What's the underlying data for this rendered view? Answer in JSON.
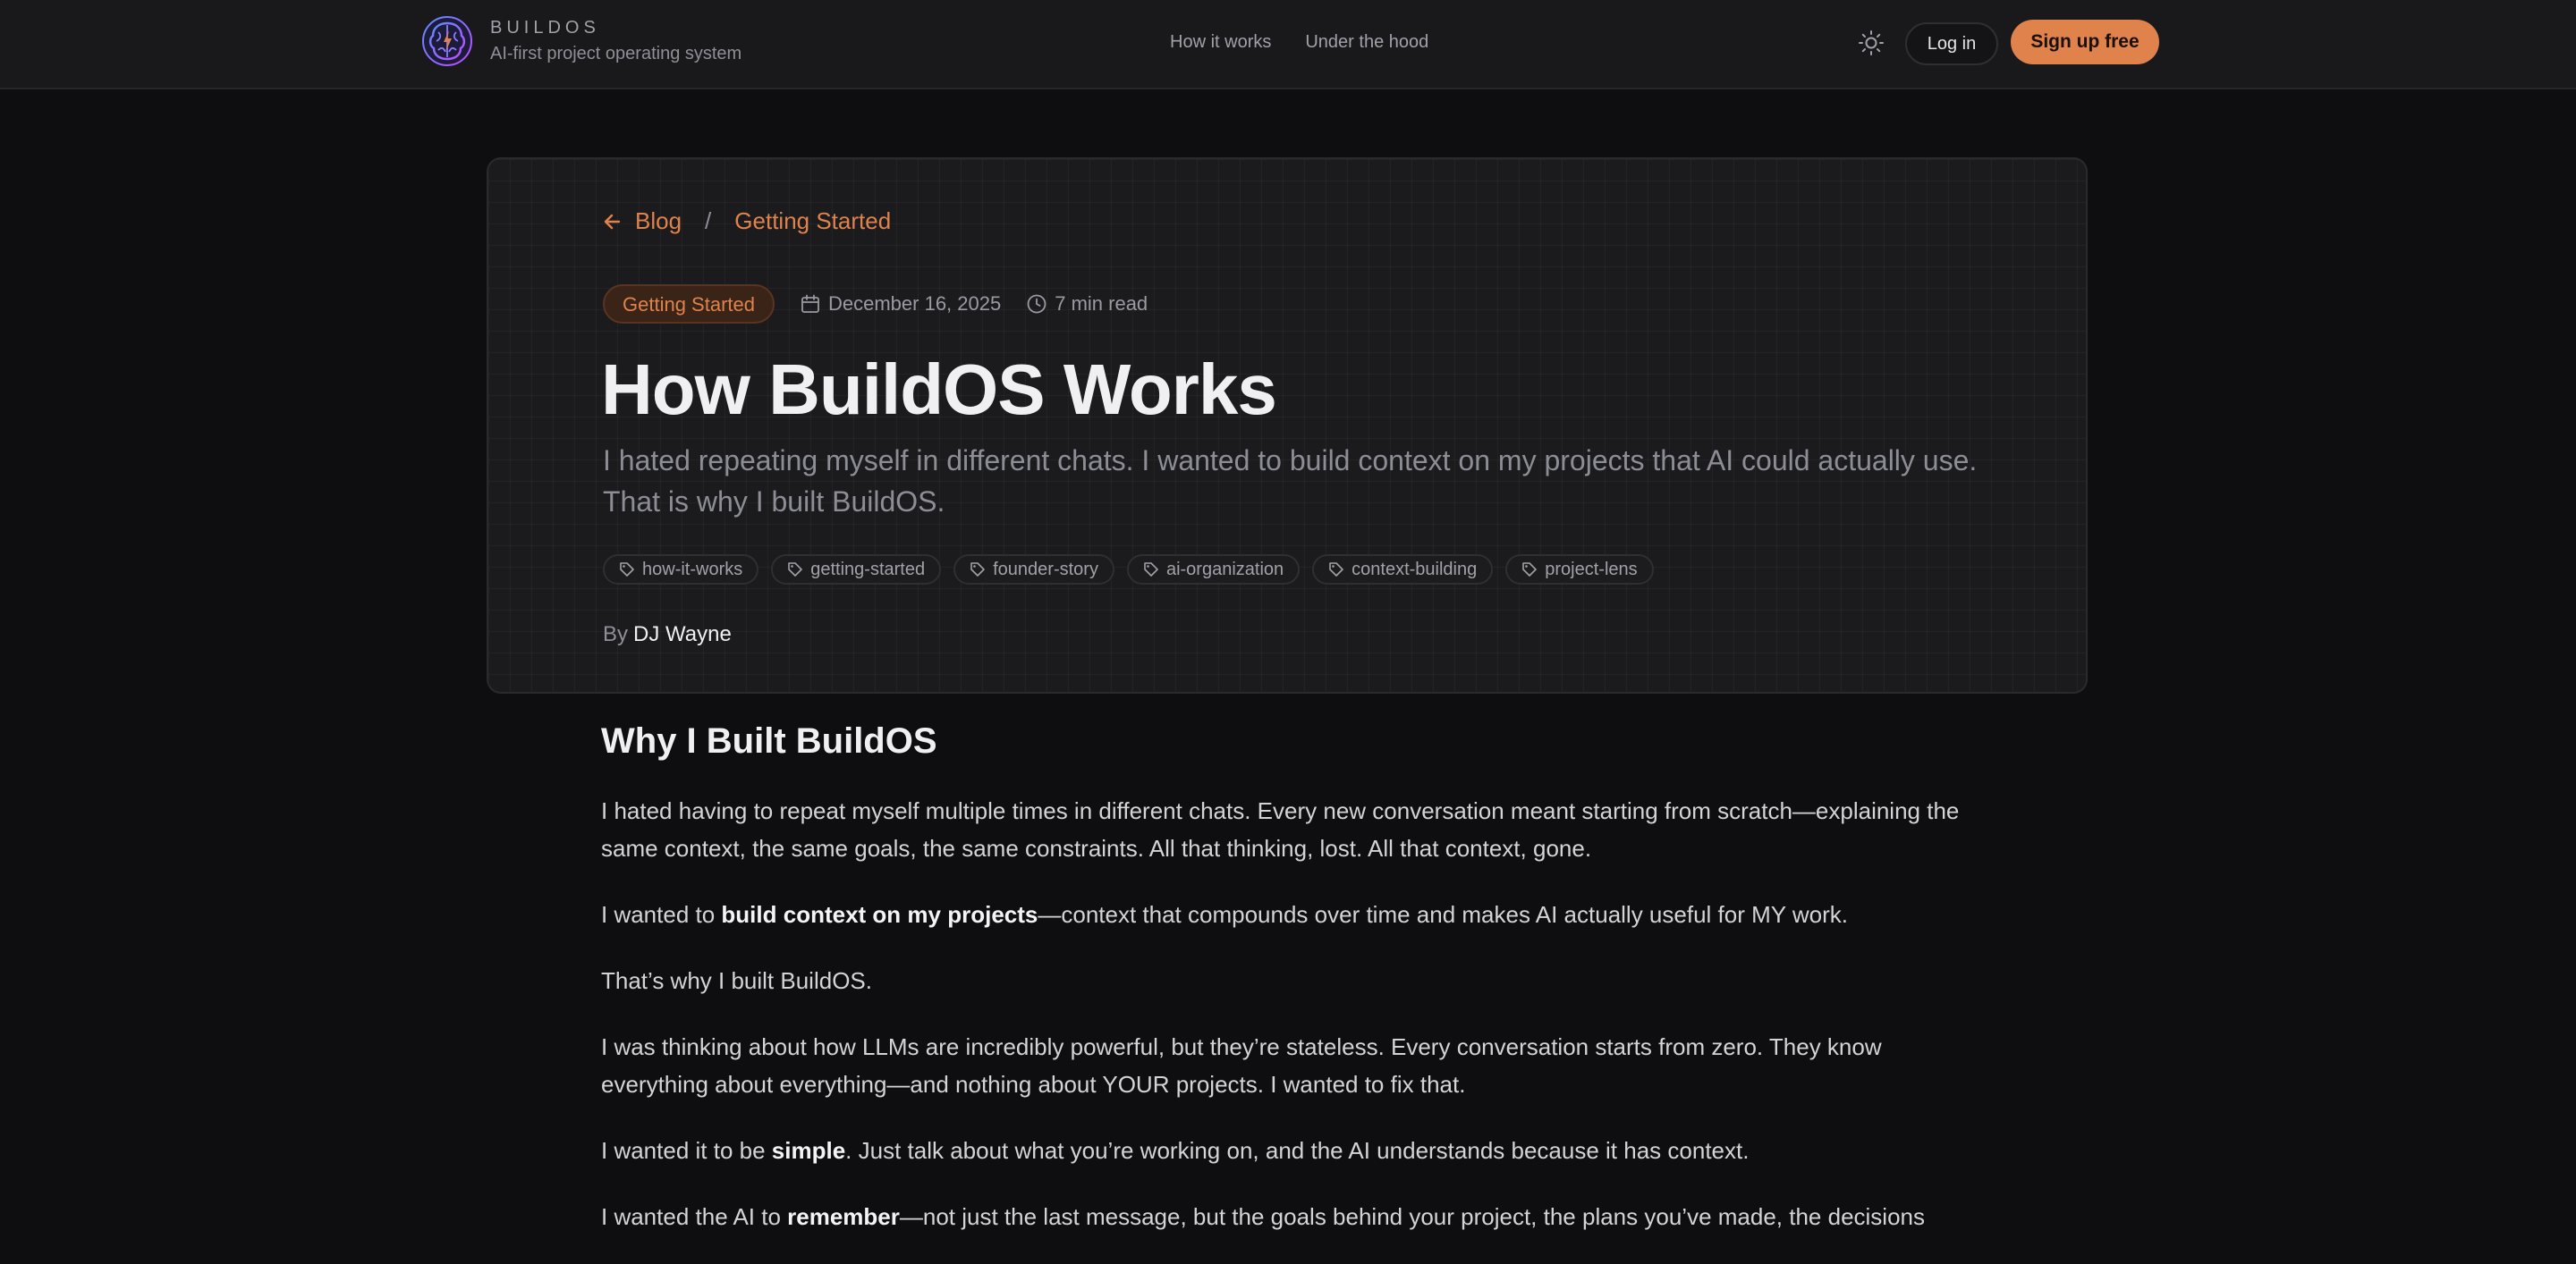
{
  "header": {
    "brand_name": "BUILDOS",
    "brand_tagline": "AI-first project operating system",
    "nav": [
      {
        "label": "How it works"
      },
      {
        "label": "Under the hood"
      }
    ],
    "theme_icon": "sun-icon",
    "login_label": "Log in",
    "signup_label": "Sign up free",
    "accent_color": "#e0824b"
  },
  "post": {
    "breadcrumb": {
      "back_label": "Blog",
      "separator": "/",
      "current": "Getting Started"
    },
    "category": "Getting Started",
    "date": "December 16, 2025",
    "read_time": "7 min read",
    "title": "How BuildOS Works",
    "subtitle": "I hated repeating myself in different chats. I wanted to build context on my projects that AI could actually use. That is why I built BuildOS.",
    "tags": [
      "how-it-works",
      "getting-started",
      "founder-story",
      "ai-organization",
      "context-building",
      "project-lens"
    ],
    "byline_prefix": "By",
    "author": "DJ Wayne"
  },
  "article": {
    "heading": "Why I Built BuildOS",
    "p1": "I hated having to repeat myself multiple times in different chats. Every new conversation meant starting from scratch—explaining the same context, the same goals, the same constraints. All that thinking, lost. All that context, gone.",
    "p2_pre": "I wanted to ",
    "p2_bold": "build context on my projects",
    "p2_post": "—context that compounds over time and makes AI actually useful for MY work.",
    "p3": "That’s why I built BuildOS.",
    "p4": "I was thinking about how LLMs are incredibly powerful, but they’re stateless. Every conversation starts from zero. They know everything about everything—and nothing about YOUR projects. I wanted to fix that.",
    "p5_pre": "I wanted it to be ",
    "p5_bold": "simple",
    "p5_post": ". Just talk about what you’re working on, and the AI understands because it has context.",
    "p6_pre": "I wanted the AI to ",
    "p6_bold": "remember",
    "p6_post": "—not just the last message, but the goals behind your project, the plans you’ve made, the decisions"
  }
}
